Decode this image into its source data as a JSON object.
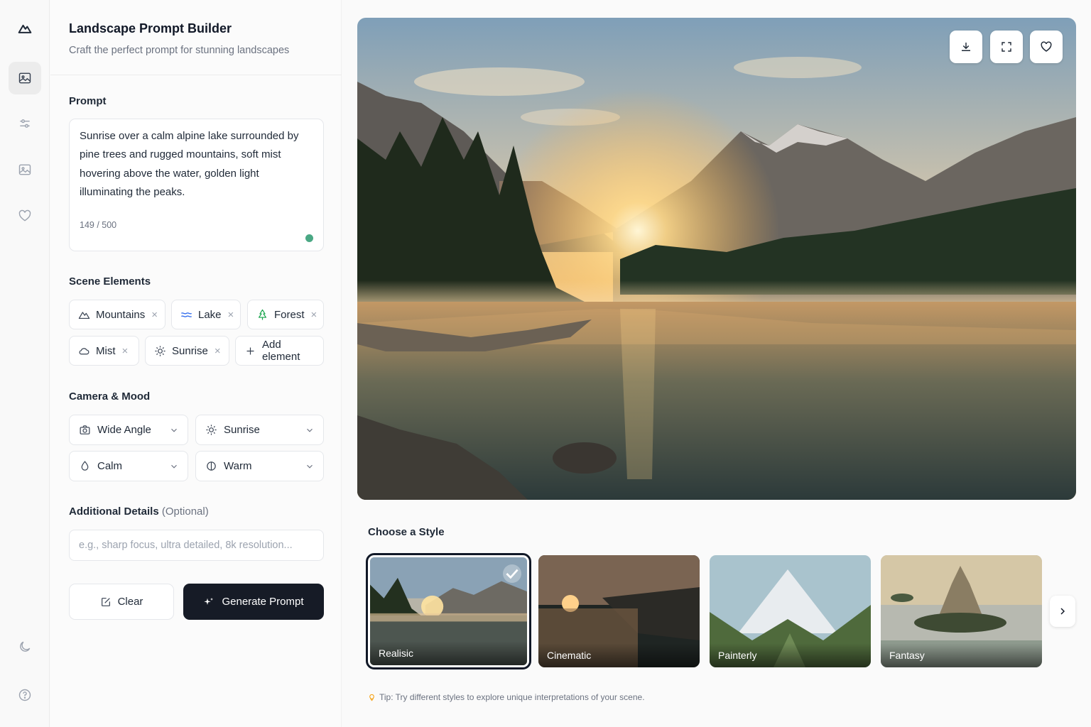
{
  "header": {
    "title": "Landscape Prompt Builder",
    "subtitle": "Craft the perfect prompt for stunning landscapes"
  },
  "rail": {
    "items": [
      "logo",
      "image-prompt",
      "adjustments",
      "gallery",
      "favorites",
      "theme-toggle",
      "help"
    ]
  },
  "prompt": {
    "label": "Prompt",
    "text": "Sunrise over a calm alpine lake surrounded by pine trees and rugged mountains, soft mist hovering above the water, golden light illuminating the peaks.",
    "count": "149 / 500",
    "status_color": "#4aa884"
  },
  "scene": {
    "label": "Scene Elements",
    "chips": [
      {
        "label": "Mountains",
        "icon": "mountain-icon"
      },
      {
        "label": "Lake",
        "icon": "waves-icon"
      },
      {
        "label": "Forest",
        "icon": "tree-icon"
      },
      {
        "label": "Mist",
        "icon": "cloud-icon"
      },
      {
        "label": "Sunrise",
        "icon": "sun-icon"
      }
    ],
    "add_label": "Add element",
    "remove_glyph": "×"
  },
  "camera": {
    "label": "Camera & Mood",
    "selects": [
      {
        "value": "Wide Angle",
        "icon": "camera-icon"
      },
      {
        "value": "Sunrise",
        "icon": "sun-icon"
      },
      {
        "value": "Calm",
        "icon": "droplet-icon"
      },
      {
        "value": "Warm",
        "icon": "contrast-icon"
      }
    ]
  },
  "details": {
    "label": "Additional Details",
    "optional": "(Optional)",
    "placeholder": "e.g., sharp focus, ultra detailed, 8k resolution...",
    "value": ""
  },
  "actions": {
    "clear": "Clear",
    "generate": "Generate Prompt",
    "generate_bg": "#161b26"
  },
  "styles": {
    "heading": "Choose a Style",
    "items": [
      {
        "label": "Realisic",
        "selected": true
      },
      {
        "label": "Cinematic",
        "selected": false
      },
      {
        "label": "Painterly",
        "selected": false
      },
      {
        "label": "Fantasy",
        "selected": false
      }
    ]
  },
  "tip": "Tip: Try different styles to explore unique interpretations of your scene.",
  "preview_tools": [
    "download-icon",
    "expand-icon",
    "heart-icon"
  ]
}
